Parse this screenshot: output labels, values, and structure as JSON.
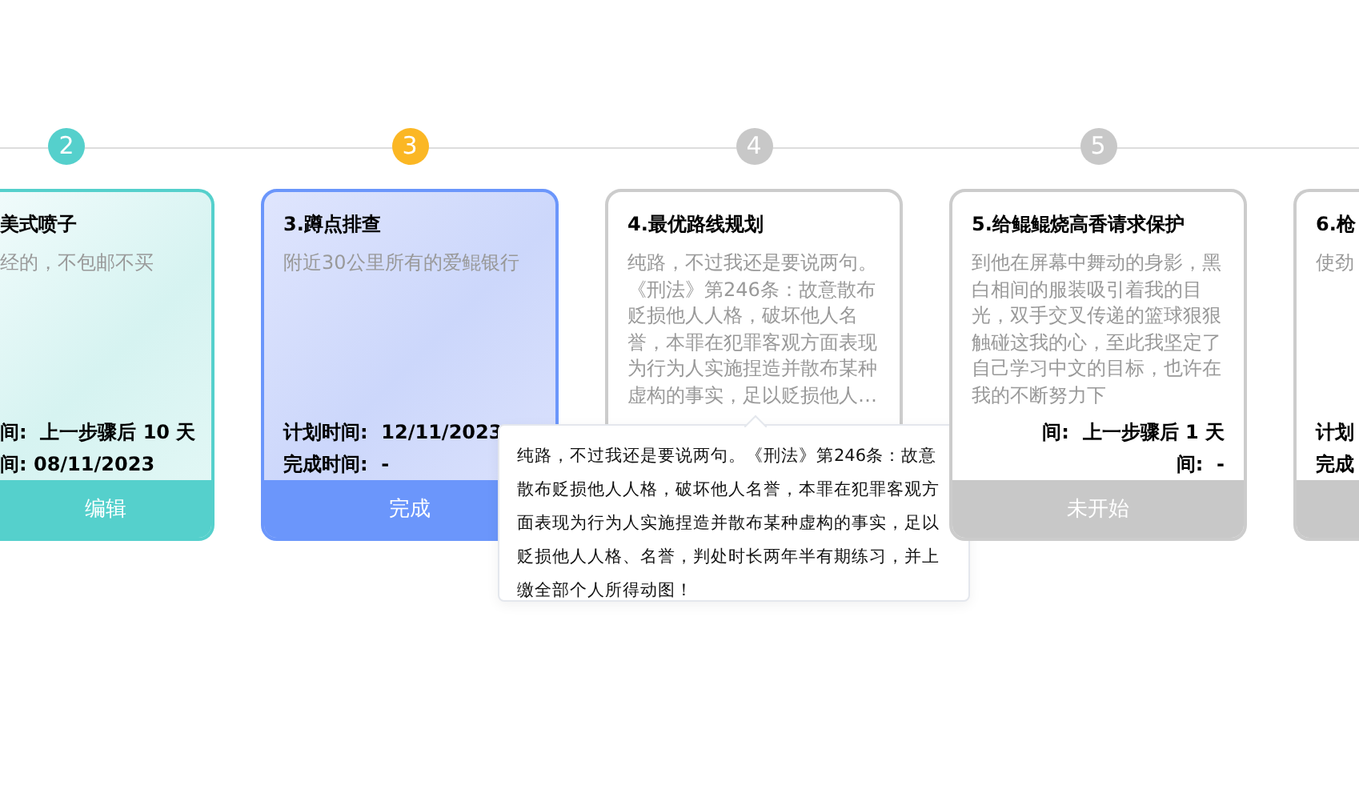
{
  "steps": [
    {
      "kind": "clipped-left",
      "number": "2",
      "done": true,
      "current": false,
      "title": "美式喷子",
      "description": "经的，不包邮不买",
      "plan": "间:  上一步骤后 10 天",
      "finished": "间: 08/11/2023",
      "button": "编辑"
    },
    {
      "kind": "full",
      "number": "3",
      "done": false,
      "current": true,
      "title": "3.蹲点排查",
      "description": "附近30公里所有的爱鲲银行",
      "plan": "计划时间:  12/11/2023",
      "finished": "完成时间:  -",
      "button": "完成"
    },
    {
      "kind": "full",
      "number": "4",
      "done": false,
      "current": false,
      "title": "4.最优路线规划",
      "description": "纯路，不过我还是要说两句。《刑法》第246条：故意散布贬损他人人格，破坏他人名誉，本罪在犯罪客观方面表现为行为人实施捏造并散布某种虚构的事实，足以贬损他人…",
      "tooltip": "纯路，不过我还是要说两句。《刑法》第246条：故意散布贬损他人人格，破坏他人名誉，本罪在犯罪客观方面表现为行为人实施捏造并散布某种虚构的事实，足以贬损他人人格、名誉，判处时长两年半有期练习，并上缴全部个人所得动图！"
    },
    {
      "kind": "full",
      "number": "5",
      "done": false,
      "current": false,
      "title": "5.给鲲鲲烧高香请求保护",
      "description": "到他在屏幕中舞动的身影，黑白相间的服装吸引着我的目光，双手交叉传递的篮球狠狠触碰这我的心，至此我坚定了自己学习中文的目标，也许在我的不断努力下",
      "plan": "间:  上一步骤后 1 天",
      "finished": "间:  -",
      "button": "未开始"
    },
    {
      "kind": "clipped-right",
      "done": false,
      "current": false,
      "title": "6.枪",
      "description": "使劲",
      "plan": "计划",
      "finished": "完成"
    }
  ]
}
